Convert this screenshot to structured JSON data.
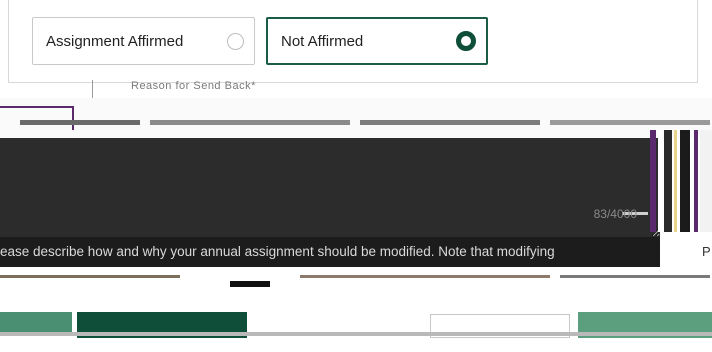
{
  "assignment": {
    "options": [
      {
        "label": "Assignment Affirmed",
        "selected": false
      },
      {
        "label": "Not Affirmed",
        "selected": true
      }
    ]
  },
  "reason": {
    "label": "Reason for Send Back*",
    "counter": "83/4000",
    "helper_text": "ease describe how and why your annual assignment should be modified. Note that modifying",
    "helper_right": "P"
  },
  "colors": {
    "accent": "#0f4f3a",
    "selected_border": "#1a5c44"
  }
}
